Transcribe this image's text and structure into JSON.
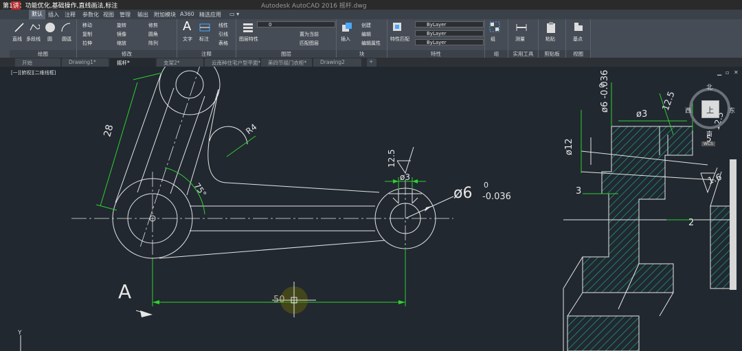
{
  "title_bar": {
    "caption": "第1讲：功能优化,基础操作,直线画法,标注",
    "app_title": "Autodesk AutoCAD 2016    摇杆.dwg"
  },
  "ribbon_tabs": [
    "默认",
    "插入",
    "注释",
    "参数化",
    "视图",
    "管理",
    "输出",
    "附加模块",
    "A360",
    "精选应用"
  ],
  "ribbon": {
    "draw": {
      "label": "绘图",
      "items": [
        "直线",
        "多段线",
        "圆",
        "圆弧"
      ]
    },
    "modify": {
      "label": "修改",
      "items": [
        "移动",
        "旋转",
        "修剪",
        "复制",
        "镜像",
        "圆角",
        "拉伸",
        "缩放",
        "阵列"
      ]
    },
    "annotation": {
      "label": "注释",
      "items": [
        "文字",
        "标注",
        "线性",
        "引线",
        "表格"
      ]
    },
    "layers": {
      "label": "图层",
      "items": [
        "图层特性",
        "置为当前",
        "匹配图层"
      ],
      "current_layer": "0"
    },
    "block": {
      "label": "块",
      "items": [
        "插入",
        "创建",
        "编辑",
        "编辑属性"
      ]
    },
    "properties": {
      "label": "特性",
      "items": [
        "特性匹配"
      ],
      "color": "ByLayer",
      "linetype": "ByLayer",
      "lineweight": "ByLayer"
    },
    "groups": {
      "label": "组",
      "items": [
        "组"
      ]
    },
    "utilities": {
      "label": "实用工具",
      "items": [
        "测量"
      ]
    },
    "clipboard": {
      "label": "剪贴板",
      "items": [
        "粘贴"
      ]
    },
    "view": {
      "label": "视图",
      "items": [
        "基点"
      ]
    }
  },
  "doc_tabs": [
    {
      "label": "开始",
      "active": false
    },
    {
      "label": "Drawing1*",
      "active": false
    },
    {
      "label": "摇杆*",
      "active": true
    },
    {
      "label": "支架2*",
      "active": false
    },
    {
      "label": "云南种住宅户型平面*",
      "active": false
    },
    {
      "label": "美四节摇门衣柜*",
      "active": false
    },
    {
      "label": "Drawing2",
      "active": false
    }
  ],
  "viewport_label": "[一][俯视][二维线框]",
  "viewcube": {
    "north": "北",
    "south": "南",
    "east": "东",
    "west": "西",
    "face": "上",
    "wcs": "WCS"
  },
  "drawing": {
    "dim_28": "28",
    "dim_r4": "R4",
    "dim_75": "75°",
    "dim_12_5": "12.5",
    "dim_phi3": "ø3",
    "dim_phi6": "ø6",
    "dim_tol_upper": "0",
    "dim_tol_lower": "-0.036",
    "dim_50": "50",
    "label_a": "A",
    "right_phi6": "ø6 -0.036",
    "right_zero": "0",
    "right_phi3": "ø3",
    "right_12_5": "12.5",
    "right_phi12": "ø12",
    "right_3": "3",
    "right_1_6": "1.6",
    "right_2": "2",
    "right_12_5b": "12.5",
    "right_5": "5",
    "ucs_y": "Y"
  },
  "colors": {
    "canvas": "#212830",
    "geometry": "#e6e6e6",
    "dimension": "#2fd12f",
    "hatch": "#1fa58a",
    "ribbon": "#454c55"
  }
}
